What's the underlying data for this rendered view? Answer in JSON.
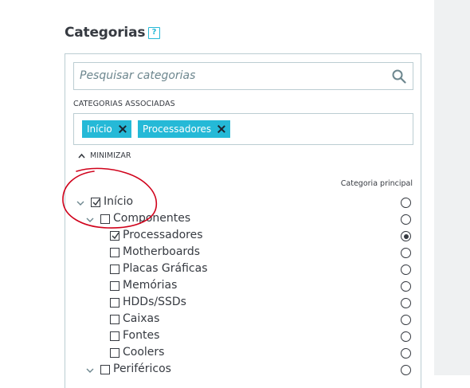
{
  "header": {
    "title": "Categorias",
    "help_icon": "?"
  },
  "search": {
    "placeholder": "Pesquisar categorias",
    "icon": "search-icon"
  },
  "associated": {
    "label": "CATEGORIAS ASSOCIADAS",
    "tags": [
      {
        "label": "Início"
      },
      {
        "label": "Processadores"
      }
    ]
  },
  "tree": {
    "minimize_label": "MINIMIZAR",
    "main_category_label": "Categoria principal",
    "rows": [
      {
        "label": "Início",
        "level": 0,
        "expandable": true,
        "checked": true,
        "main": false
      },
      {
        "label": "Componentes",
        "level": 1,
        "expandable": true,
        "checked": false,
        "main": false
      },
      {
        "label": "Processadores",
        "level": 2,
        "expandable": false,
        "checked": true,
        "main": true
      },
      {
        "label": "Motherboards",
        "level": 2,
        "expandable": false,
        "checked": false,
        "main": false
      },
      {
        "label": "Placas Gráficas",
        "level": 2,
        "expandable": false,
        "checked": false,
        "main": false
      },
      {
        "label": "Memórias",
        "level": 2,
        "expandable": false,
        "checked": false,
        "main": false
      },
      {
        "label": "HDDs/SSDs",
        "level": 2,
        "expandable": false,
        "checked": false,
        "main": false
      },
      {
        "label": "Caixas",
        "level": 2,
        "expandable": false,
        "checked": false,
        "main": false
      },
      {
        "label": "Fontes",
        "level": 2,
        "expandable": false,
        "checked": false,
        "main": false
      },
      {
        "label": "Coolers",
        "level": 2,
        "expandable": false,
        "checked": false,
        "main": false
      },
      {
        "label": "Periféricos",
        "level": 1,
        "expandable": true,
        "checked": false,
        "main": false
      }
    ]
  },
  "colors": {
    "accent": "#25b9d7",
    "text": "#363a41",
    "border": "#bbcdd2",
    "annotation": "#d0021b"
  }
}
